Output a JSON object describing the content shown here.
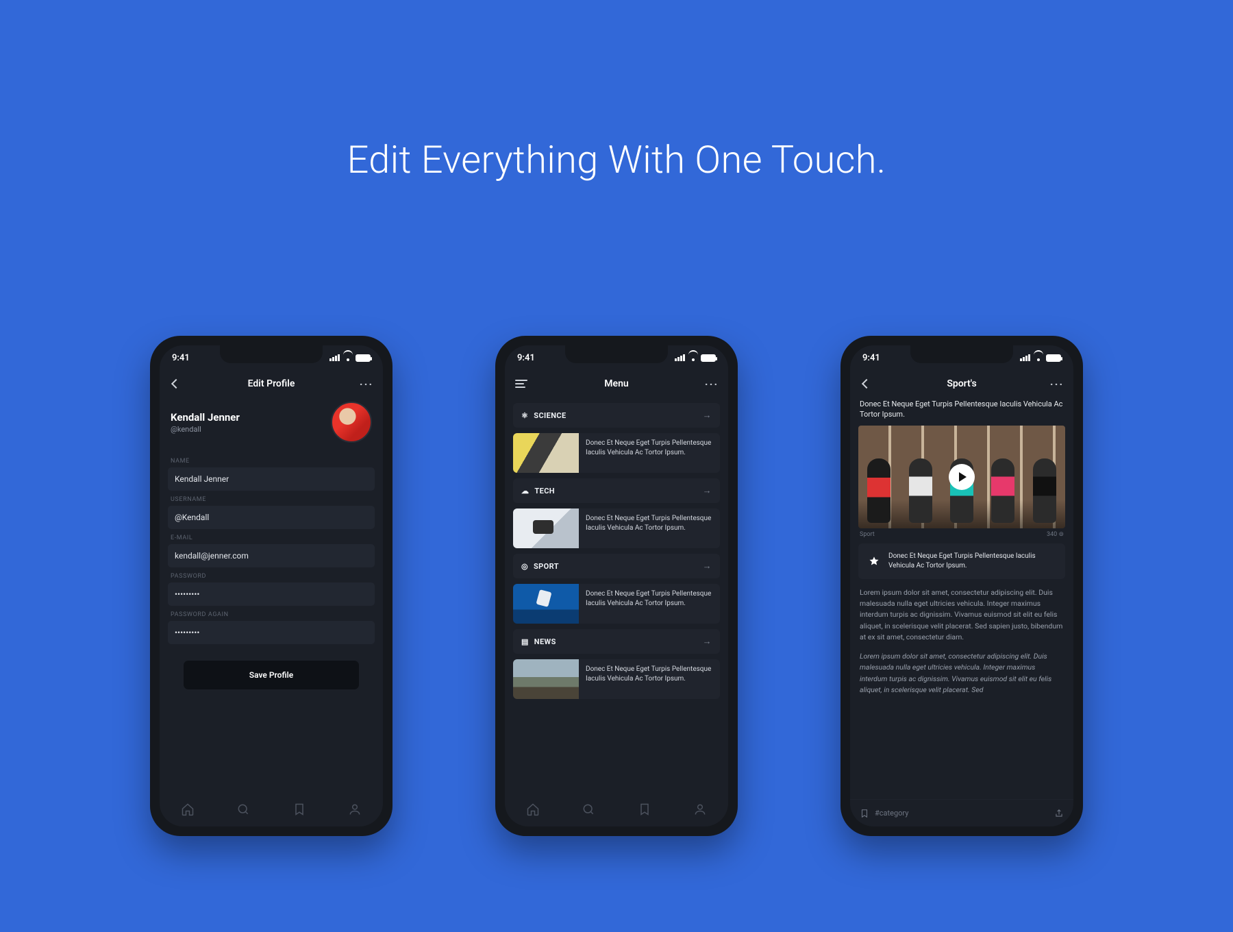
{
  "headline": "Edit Everything With One Touch.",
  "status": {
    "time": "9:41"
  },
  "phone1": {
    "title": "Edit Profile",
    "name": "Kendall Jenner",
    "handle": "@kendall",
    "labels": {
      "name": "NAME",
      "username": "USERNAME",
      "email": "E-MAIL",
      "password": "PASSWORD",
      "password2": "PASSWORD AGAIN"
    },
    "values": {
      "name": "Kendall Jenner",
      "username": "@Kendall",
      "email": "kendall@jenner.com",
      "password": "•••••••••",
      "password2": "•••••••••"
    },
    "save": "Save Profile"
  },
  "phone2": {
    "title": "Menu",
    "item_text": "Donec Et Neque Eget Turpis Pellentesque Iaculis Vehicula Ac Tortor Ipsum.",
    "cats": {
      "science": "SCIENCE",
      "tech": "TECH",
      "sport": "SPORT",
      "news": "NEWS"
    }
  },
  "phone3": {
    "title": "Sport's",
    "article_title": "Donec Et Neque Eget Turpis Pellentesque Iaculis Vehicula Ac Tortor Ipsum.",
    "meta_left": "Sport",
    "meta_right": "340 ⊚",
    "star_text": "Donec Et Neque Eget Turpis Pellentesque Iaculis Vehicula Ac Tortor Ipsum.",
    "para1": "Lorem ipsum dolor sit amet, consectetur adipiscing elit. Duis malesuada nulla eget ultricies vehicula. Integer maximus interdum turpis ac dignissim. Vivamus euismod sit elit eu felis aliquet, in  scelerisque  velit placerat. Sed sapien justo, bibendum at ex sit amet, consectetur diam.",
    "para2": "Lorem ipsum dolor sit amet, consectetur adipiscing elit. Duis malesuada nulla eget ultricies vehicula. Integer maximus interdum turpis ac dignissim. Vivamus euismod sit elit eu felis aliquet, in  scelerisque  velit placerat. Sed",
    "footer_tag": "#category"
  }
}
